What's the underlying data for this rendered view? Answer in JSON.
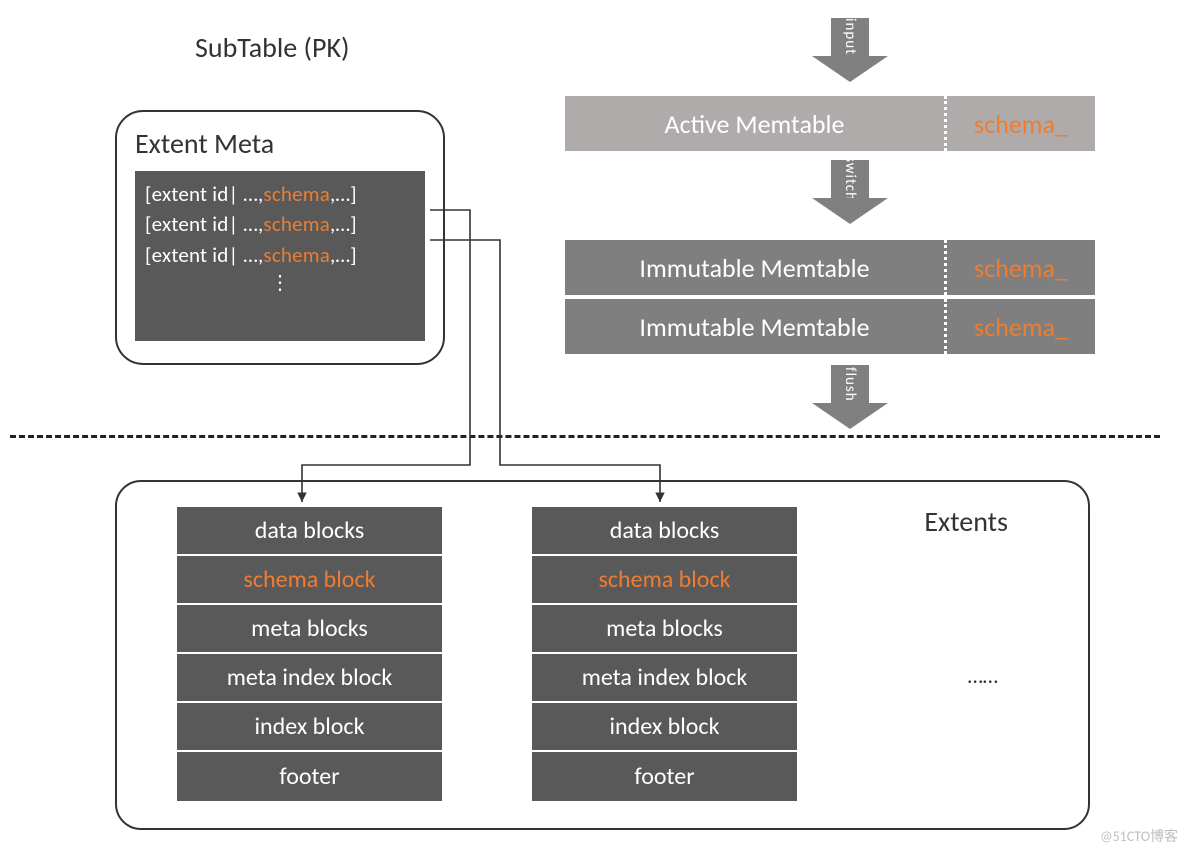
{
  "title": "SubTable (PK)",
  "arrows": {
    "input": "input",
    "switch": "switch",
    "flush": "flush"
  },
  "extent_meta": {
    "label": "Extent Meta",
    "rows": [
      {
        "pre": "[extent id| …,",
        "orange": "schema",
        "post": ",…]"
      },
      {
        "pre": "[extent id| …,",
        "orange": "schema",
        "post": ",…]"
      },
      {
        "pre": "[extent id| …,",
        "orange": "schema",
        "post": ",…]"
      }
    ],
    "dots": "⋮"
  },
  "memtables": {
    "active": {
      "label": "Active Memtable",
      "schema": "schema_"
    },
    "immutable": [
      {
        "label": "Immutable Memtable",
        "schema": "schema_"
      },
      {
        "label": "Immutable Memtable",
        "schema": "schema_"
      }
    ]
  },
  "extents": {
    "label": "Extents",
    "dots": "……",
    "columns": [
      [
        "data blocks",
        "schema block",
        "meta blocks",
        "meta index block",
        "index block",
        "footer"
      ],
      [
        "data blocks",
        "schema block",
        "meta blocks",
        "meta index block",
        "index block",
        "footer"
      ]
    ]
  },
  "watermark": "@51CTO博客"
}
